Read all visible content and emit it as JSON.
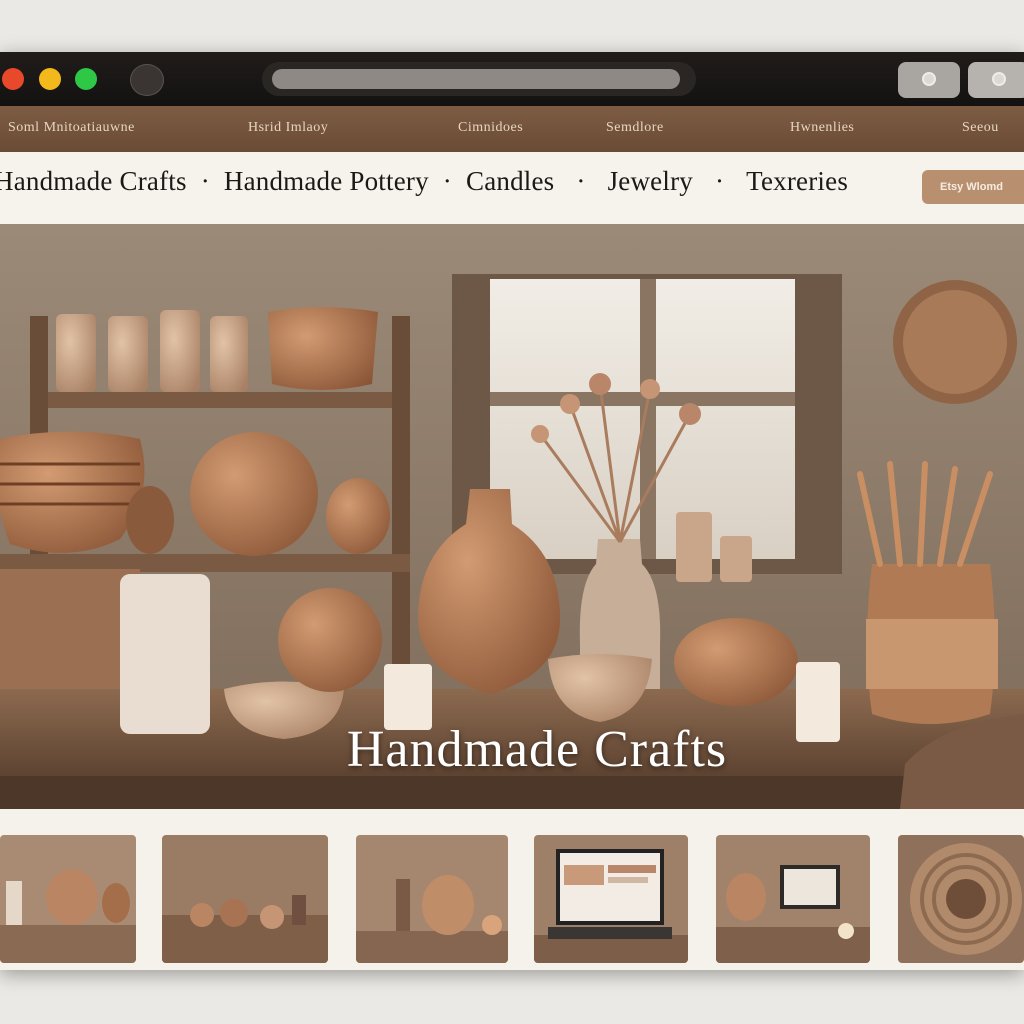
{
  "window": {
    "controls": [
      "close",
      "minimize",
      "maximize"
    ]
  },
  "topnav": {
    "items": [
      {
        "label": "Soml Mnitoatiauwne"
      },
      {
        "label": "Hsrid  Imlaoy"
      },
      {
        "label": "Cimnidoes"
      },
      {
        "label": "Semdlore"
      },
      {
        "label": "Hwnenlies"
      },
      {
        "label": "Seeou"
      }
    ]
  },
  "categories": {
    "items": [
      {
        "label": "Handmade Crafts"
      },
      {
        "label": "Handmade Pottery"
      },
      {
        "label": "Candles"
      },
      {
        "label": "Jewelry"
      },
      {
        "label": "Texreries"
      }
    ],
    "separator": "·",
    "cta_label": "Etsy Wlomd"
  },
  "hero": {
    "title": "Handmade Crafts"
  },
  "thumbnails": [
    {
      "subject": "pottery-collection"
    },
    {
      "subject": "craft-workshop"
    },
    {
      "subject": "vases-and-bowls"
    },
    {
      "subject": "laptop-shop"
    },
    {
      "subject": "studio-desk"
    },
    {
      "subject": "woven-basket"
    }
  ],
  "colors": {
    "titlebar": "#1a1716",
    "topnav": "#735239",
    "accent_button": "#b9906f",
    "terracotta": "#b07a55"
  }
}
